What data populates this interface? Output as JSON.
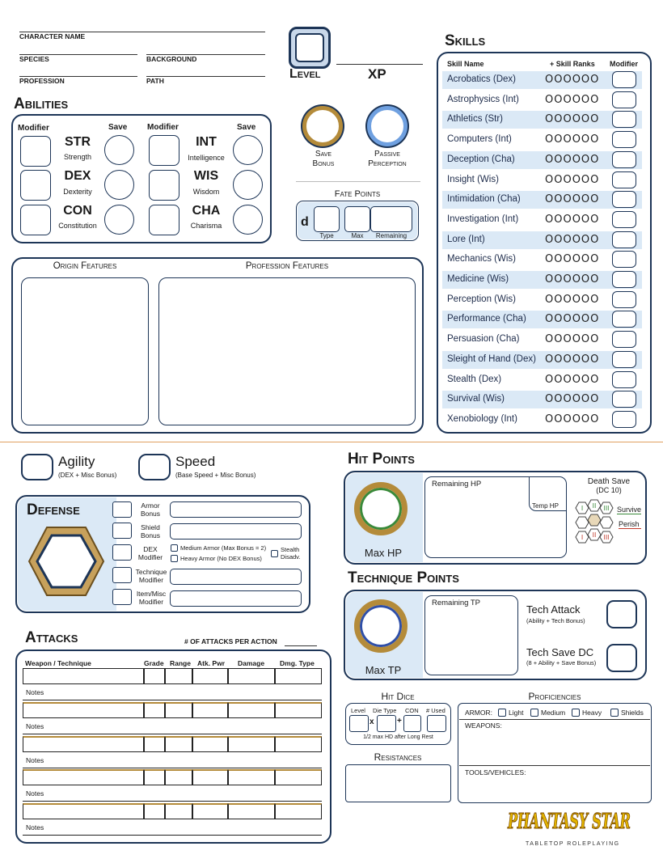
{
  "header": {
    "character_name": "CHARACTER NAME",
    "species": "SPECIES",
    "background": "BACKGROUND",
    "profession": "PROFESSION",
    "path": "PATH",
    "level": "Level",
    "xp": "XP"
  },
  "abilities": {
    "title": "Abilities",
    "modifier": "Modifier",
    "save": "Save",
    "items": [
      {
        "abbr": "STR",
        "name": "Strength"
      },
      {
        "abbr": "DEX",
        "name": "Dexterity"
      },
      {
        "abbr": "CON",
        "name": "Constitution"
      },
      {
        "abbr": "INT",
        "name": "Intelligence"
      },
      {
        "abbr": "WIS",
        "name": "Wisdom"
      },
      {
        "abbr": "CHA",
        "name": "Charisma"
      }
    ]
  },
  "save_bonus": {
    "line1": "Save",
    "line2": "Bonus"
  },
  "passive_perception": {
    "line1": "Passive",
    "line2": "Perception"
  },
  "fate_points": {
    "title": "Fate Points",
    "d": "d",
    "type": "Type",
    "max": "Max",
    "remaining": "Remaining"
  },
  "features": {
    "origin": "Origin Features",
    "profession": "Profession Features"
  },
  "skills": {
    "title": "Skills",
    "col_name": "Skill Name",
    "col_ranks": "+ Skill Ranks",
    "col_modifier": "Modifier",
    "rank_dots": "OOOOOO",
    "items": [
      "Acrobatics (Dex)",
      "Astrophysics (Int)",
      "Athletics (Str)",
      "Computers (Int)",
      "Deception (Cha)",
      "Insight (Wis)",
      "Intimidation (Cha)",
      "Investigation (Int)",
      "Lore (Int)",
      "Mechanics (Wis)",
      "Medicine (Wis)",
      "Perception (Wis)",
      "Performance (Cha)",
      "Persuasion (Cha)",
      "Sleight of Hand (Dex)",
      "Stealth (Dex)",
      "Survival (Wis)",
      "Xenobiology (Int)"
    ]
  },
  "agility": {
    "title": "Agility",
    "sub": "(DEX + Misc Bonus)"
  },
  "speed": {
    "title": "Speed",
    "sub": "(Base Speed + Misc Bonus)"
  },
  "defense": {
    "title": "Defense",
    "armor_bonus": "Armor Bonus",
    "shield_bonus": "Shield Bonus",
    "dex_modifier": "DEX Modifier",
    "technique_modifier": "Technique Modifier",
    "item_misc_modifier": "Item/Misc Modifier",
    "medium_armor": "Medium Armor (Max Bonus = 2)",
    "heavy_armor": "Heavy Armor (No DEX Bonus)",
    "stealth": "Stealth Disadv."
  },
  "hit_points": {
    "title": "Hit Points",
    "remaining": "Remaining HP",
    "temp": "Temp HP",
    "max": "Max HP",
    "death_save": "Death Save",
    "death_dc": "(DC 10)",
    "survive": "Survive",
    "perish": "Perish",
    "colors": {
      "survive": "#3a8a3a",
      "perish": "#c0392b",
      "gold": "#b48b3a"
    }
  },
  "technique_points": {
    "title": "Technique Points",
    "remaining": "Remaining TP",
    "max": "Max TP",
    "tech_attack": "Tech Attack",
    "tech_attack_sub": "(Ability + Tech Bonus)",
    "tech_save": "Tech Save DC",
    "tech_save_sub": "(8 + Ability + Save Bonus)"
  },
  "attacks": {
    "title": "Attacks",
    "per_action": "# OF ATTACKS PER ACTION",
    "cols": [
      "Weapon / Technique",
      "Grade",
      "Range",
      "Atk. Pwr",
      "Damage",
      "Dmg. Type"
    ],
    "notes": "Notes"
  },
  "hit_dice": {
    "title": "Hit Dice",
    "level": "Level",
    "die_type": "Die Type",
    "con": "CON",
    "used": "# Used",
    "note": "1/2 max HD after Long Rest"
  },
  "resistances": {
    "title": "Resistances"
  },
  "proficiencies": {
    "title": "Proficiencies",
    "armor": "ARMOR:",
    "armor_opts": [
      "Light",
      "Medium",
      "Heavy",
      "Shields"
    ],
    "weapons": "WEAPONS:",
    "tools": "TOOLS/VEHICLES:"
  },
  "logo": {
    "title": "Phantasy Star",
    "sub": "TABLETOP ROLEPLAYING"
  }
}
